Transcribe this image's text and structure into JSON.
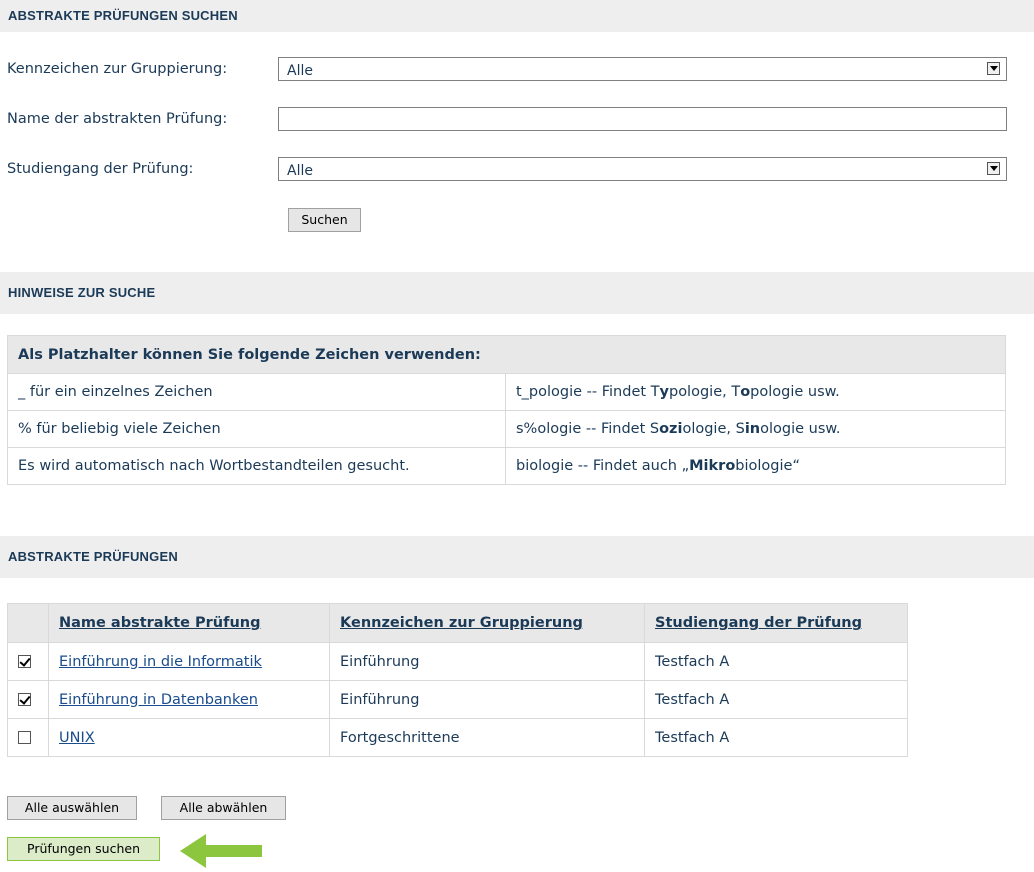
{
  "search_section": {
    "title": "ABSTRAKTE PRÜFUNGEN SUCHEN",
    "grouping_label": "Kennzeichen zur Gruppierung:",
    "grouping_value": "Alle",
    "name_label": "Name der abstrakten Prüfung:",
    "name_value": "",
    "program_label": "Studiengang der Prüfung:",
    "program_value": "Alle",
    "search_button": "Suchen"
  },
  "hints_section": {
    "title": "HINWEISE ZUR SUCHE",
    "table_header": "Als Platzhalter können Sie folgende Zeichen verwenden:",
    "rows": [
      {
        "rule": "_ für ein einzelnes Zeichen",
        "example_prefix": "t_pologie -- Findet T",
        "example_parts": [
          "y",
          "pologie, T",
          "o",
          "pologie usw."
        ]
      },
      {
        "rule": "% für beliebig viele Zeichen",
        "example_prefix": "s%ologie -- Findet S",
        "example_parts": [
          "ozi",
          "ologie, S",
          "in",
          "ologie usw."
        ]
      },
      {
        "rule": "Es wird automatisch nach Wortbestandteilen gesucht.",
        "example_prefix": "biologie -- Findet auch „",
        "example_parts": [
          "Mikro",
          "biologie“"
        ]
      }
    ]
  },
  "results_section": {
    "title": "ABSTRAKTE PRÜFUNGEN",
    "columns": [
      "Name abstrakte Prüfung",
      "Kennzeichen zur Gruppierung",
      "Studiengang der Prüfung"
    ],
    "rows": [
      {
        "checked": true,
        "name": "Einführung in die Informatik",
        "group": "Einführung",
        "program": "Testfach A"
      },
      {
        "checked": true,
        "name": "Einführung in Datenbanken",
        "group": "Einführung",
        "program": "Testfach A"
      },
      {
        "checked": false,
        "name": "UNIX",
        "group": "Fortgeschrittene",
        "program": "Testfach A"
      }
    ],
    "select_all_button": "Alle auswählen",
    "deselect_all_button": "Alle abwählen",
    "search_exams_button": "Prüfungen suchen"
  },
  "colors": {
    "text": "#1b3a57",
    "link": "#1a4c8c",
    "header_bg": "#eeeeee",
    "accent_green": "#8cc63f"
  }
}
